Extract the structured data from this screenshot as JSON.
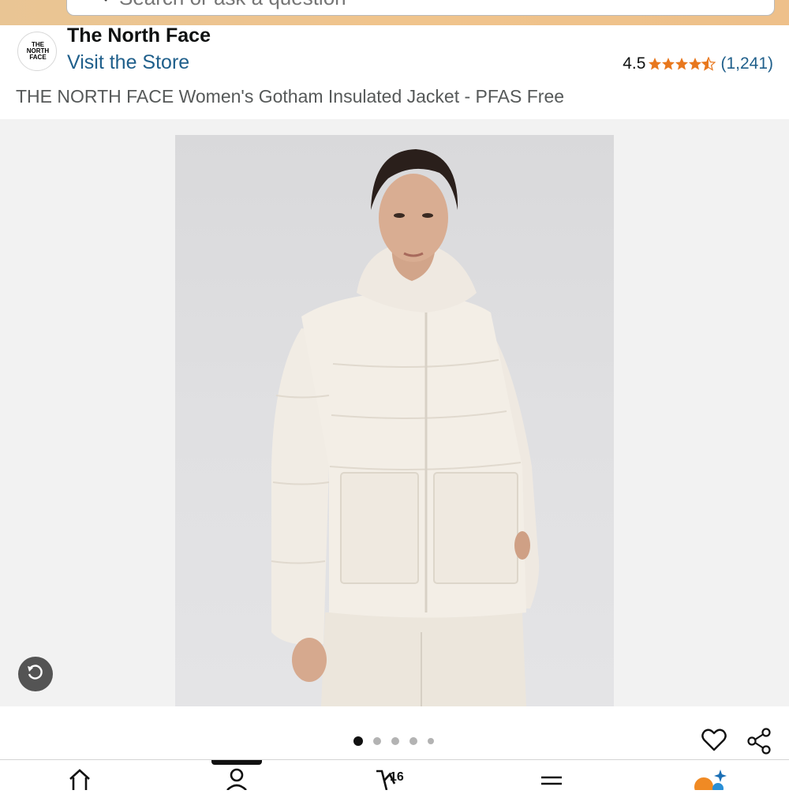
{
  "search": {
    "placeholder": "Search or ask a question"
  },
  "brand": {
    "logo_text_lines": [
      "THE",
      "NORTH",
      "FACE"
    ],
    "name": "The North Face",
    "visit_store": "Visit the Store"
  },
  "rating": {
    "value": "4.5",
    "stars": 4.5,
    "count": "(1,241)",
    "star_color": "#e8771d"
  },
  "product": {
    "title": "THE NORTH FACE Women's Gotham Insulated Jacket - PFAS Free"
  },
  "gallery": {
    "total_images": 5,
    "current_index": 0
  },
  "bottom_nav": {
    "items": [
      "home-icon",
      "account-icon",
      "cart-icon",
      "menu-icon",
      "rufus-assistant-icon"
    ],
    "active_index": 1,
    "cart_count": "16"
  },
  "colors": {
    "link": "#1f5f8b",
    "header": "#f0c48c",
    "accent": "#e8771d"
  }
}
